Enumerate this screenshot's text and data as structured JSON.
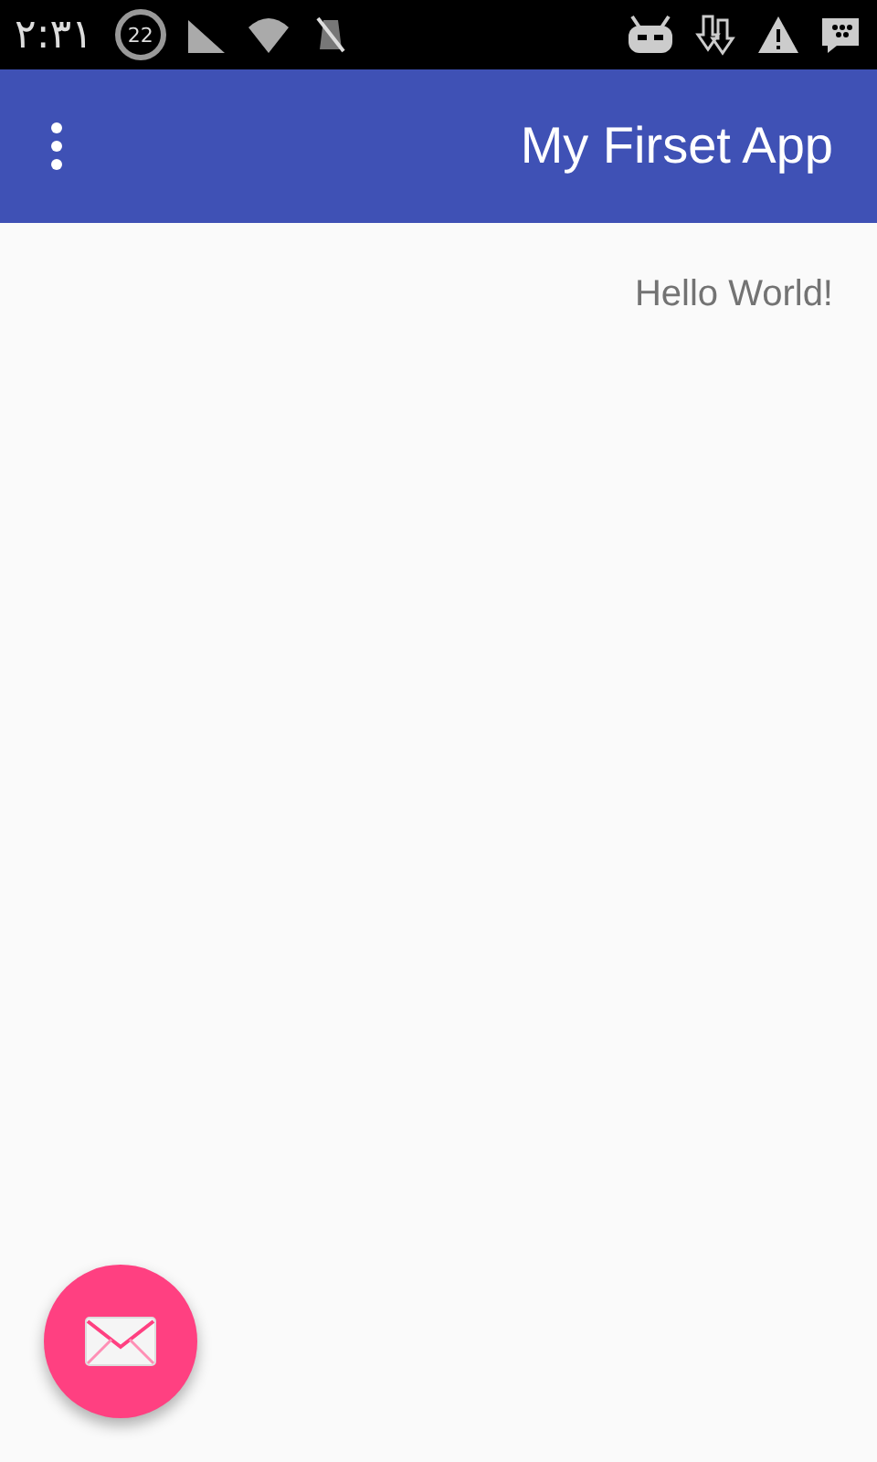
{
  "status_bar": {
    "time": "٢:٣١",
    "notification_count": "22"
  },
  "app_bar": {
    "title": "My Firset App"
  },
  "content": {
    "text": "Hello World!"
  },
  "fab": {
    "kind": "mail"
  }
}
